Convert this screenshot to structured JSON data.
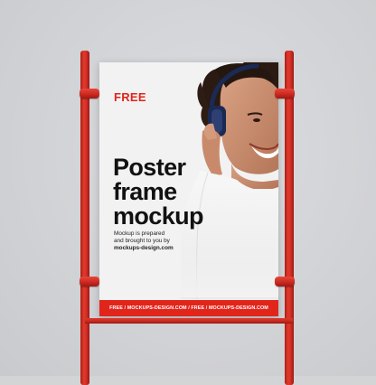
{
  "poster": {
    "badge": "FREE",
    "headline": [
      "Poster",
      "frame",
      "mockup"
    ],
    "blurb_lines": [
      "Mockup is prepared",
      "and brought to you by"
    ],
    "blurb_link": "mockups-design.com",
    "footer": "FREE / MOCKUPS-DESIGN.COM / FREE / MOCKUPS-DESIGN.COM",
    "photo_subject": "woman-with-headphones"
  },
  "colors": {
    "background": "#d3d4d6",
    "frame_red": "#d9322a",
    "brand_red": "#e1251b",
    "poster_paper": "#f2f2f3",
    "headline_text": "#111111"
  }
}
